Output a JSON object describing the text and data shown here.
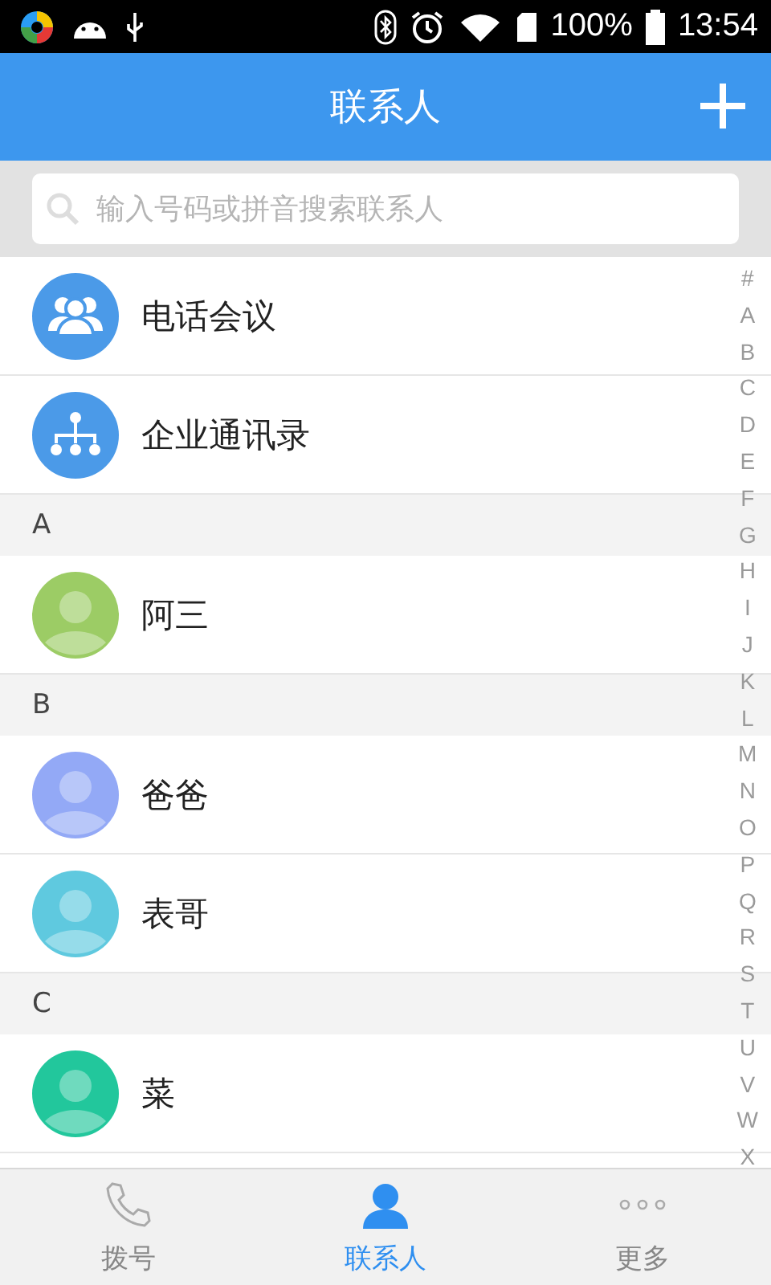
{
  "status_bar": {
    "battery": "100%",
    "time": "13:54"
  },
  "header": {
    "title": "联系人"
  },
  "search": {
    "placeholder": "输入号码或拼音搜索联系人"
  },
  "list": [
    {
      "kind": "feature",
      "name": "电话会议"
    },
    {
      "kind": "feature",
      "name": "企业通讯录"
    },
    {
      "kind": "header",
      "name": "A"
    },
    {
      "kind": "contact",
      "name": "阿三",
      "color": "#9ccc65"
    },
    {
      "kind": "header",
      "name": "B"
    },
    {
      "kind": "contact",
      "name": "爸爸",
      "color": "#93a9f6"
    },
    {
      "kind": "contact",
      "name": "表哥",
      "color": "#5fc9df"
    },
    {
      "kind": "header",
      "name": "C"
    },
    {
      "kind": "contact",
      "name": "菜",
      "color": "#22c79c"
    }
  ],
  "index": [
    "#",
    "A",
    "B",
    "C",
    "D",
    "E",
    "F",
    "G",
    "H",
    "I",
    "J",
    "K",
    "L",
    "M",
    "N",
    "O",
    "P",
    "Q",
    "R",
    "S",
    "T",
    "U",
    "V",
    "W",
    "X"
  ],
  "tabs": [
    {
      "label": "拨号",
      "selected": false
    },
    {
      "label": "联系人",
      "selected": true
    },
    {
      "label": "更多",
      "selected": false
    }
  ]
}
